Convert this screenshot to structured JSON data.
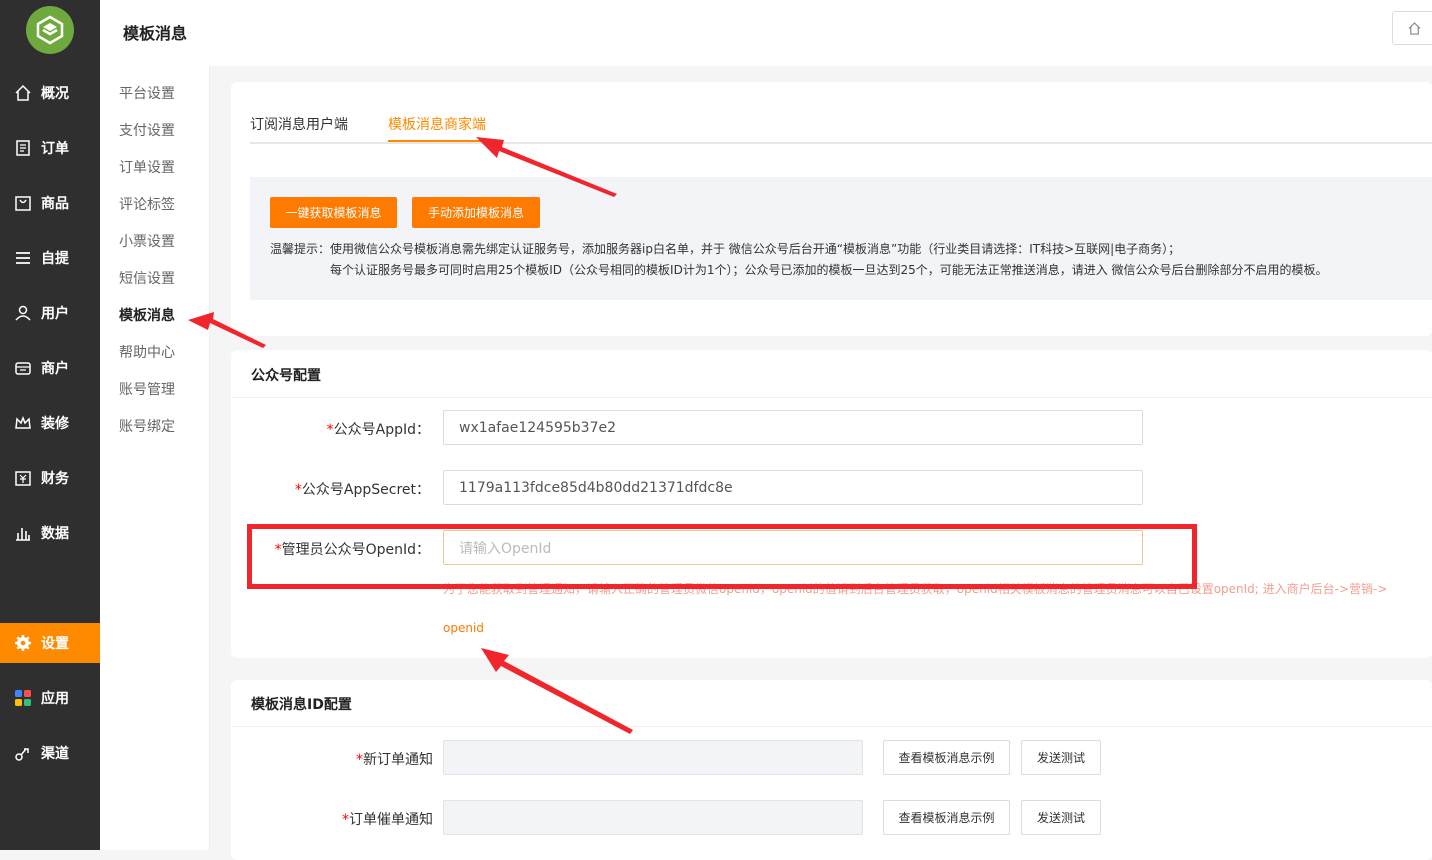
{
  "header": {
    "page_title": "模板消息"
  },
  "sidebar": {
    "items": [
      {
        "label": "概况",
        "icon": "home-icon"
      },
      {
        "label": "订单",
        "icon": "order-icon"
      },
      {
        "label": "商品",
        "icon": "goods-icon"
      },
      {
        "label": "自提",
        "icon": "list-icon"
      },
      {
        "label": "用户",
        "icon": "user-icon"
      },
      {
        "label": "商户",
        "icon": "shop-icon"
      },
      {
        "label": "装修",
        "icon": "crown-icon"
      },
      {
        "label": "财务",
        "icon": "finance-icon"
      },
      {
        "label": "数据",
        "icon": "chart-icon"
      },
      {
        "label": "设置",
        "icon": "gear-icon",
        "active": true
      },
      {
        "label": "应用",
        "icon": "apps-icon"
      },
      {
        "label": "渠道",
        "icon": "channel-icon"
      }
    ]
  },
  "subnav": {
    "items": [
      "平台设置",
      "支付设置",
      "订单设置",
      "评论标签",
      "小票设置",
      "短信设置",
      "模板消息",
      "帮助中心",
      "账号管理",
      "账号绑定"
    ],
    "active": "模板消息"
  },
  "tabs": [
    {
      "label": "订阅消息用户端",
      "active": false
    },
    {
      "label": "模板消息商家端",
      "active": true
    }
  ],
  "notice": {
    "btn_fetch": "一键获取模板消息",
    "btn_add": "手动添加模板消息",
    "line1": "温馨提示：使用微信公众号模板消息需先绑定认证服务号，添加服务器ip白名单，并于 微信公众号后台开通“模板消息”功能（行业类目请选择：IT科技>互联网|电子商务）；",
    "line2": "每个认证服务号最多可同时启用25个模板ID（公众号相同的模板ID计为1个）；公众号已添加的模板一旦达到25个，可能无法正常推送消息，请进入 微信公众号后台删除部分不启用的模板。"
  },
  "mp_config": {
    "title": "公众号配置",
    "appid_label": "公众号AppId：",
    "appid_value": "wx1afae124595b37e2",
    "secret_label": "公众号AppSecret：",
    "secret_value": "1179a113fdce85d4b80dd21371dfdc8e",
    "openid_label": "管理员公众号OpenId：",
    "openid_placeholder": "请输入OpenId",
    "hint": "为了您能获取到管理通知，请输入正确的管理员微信openid，openid的值请到后台管理员获取，openid相关模板消息的管理员消息可以自己设置openId; 进入商户后台->营销->",
    "openid_link": "openid"
  },
  "tpl_config": {
    "title": "模板消息ID配置",
    "rows": [
      {
        "label": "新订单通知",
        "value": "",
        "btn_example": "查看模板消息示例",
        "btn_test": "发送测试"
      },
      {
        "label": "订单催单通知",
        "value": "",
        "btn_example": "查看模板消息示例",
        "btn_test": "发送测试"
      }
    ]
  }
}
